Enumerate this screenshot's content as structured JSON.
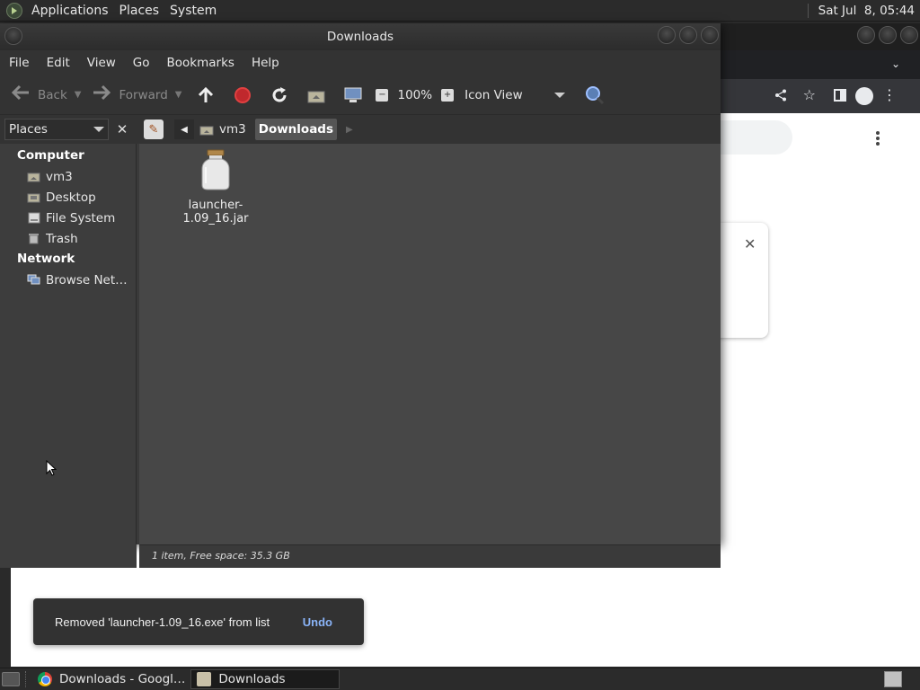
{
  "top_panel": {
    "applications": "Applications",
    "places": "Places",
    "system": "System",
    "clock": "Sat Jul  8, 05:44"
  },
  "chrome": {
    "snackbar": {
      "message": "Removed 'launcher-1.09_16.exe' from list",
      "undo": "Undo"
    }
  },
  "nautilus": {
    "title": "Downloads",
    "menu": [
      "File",
      "Edit",
      "View",
      "Go",
      "Bookmarks",
      "Help"
    ],
    "toolbar": {
      "back": "Back",
      "forward": "Forward",
      "zoom": "100%",
      "view_mode": "Icon View"
    },
    "sidebar_selector": "Places",
    "location": {
      "parent": "vm3",
      "current": "Downloads"
    },
    "sidebar": {
      "computer_header": "Computer",
      "computer_items": [
        {
          "label": "vm3",
          "icon": "home-folder-icon"
        },
        {
          "label": "Desktop",
          "icon": "desktop-folder-icon"
        },
        {
          "label": "File System",
          "icon": "drive-icon"
        },
        {
          "label": "Trash",
          "icon": "trash-icon"
        }
      ],
      "network_header": "Network",
      "network_items": [
        {
          "label": "Browse Net…",
          "icon": "network-icon"
        }
      ]
    },
    "files": [
      {
        "name": "launcher-1.09_16.jar",
        "icon": "jar-file-icon"
      }
    ],
    "status": "1 item, Free space: 35.3 GB"
  },
  "taskbar": {
    "tasks": [
      {
        "label": "Downloads - Googl…",
        "icon": "chrome-icon",
        "active": false
      },
      {
        "label": "Downloads",
        "icon": "folder-icon",
        "active": true
      }
    ]
  },
  "colors": {
    "snackbar_bg": "#323232",
    "undo_link": "#8ab4f8",
    "stop_red": "#c0282d"
  }
}
